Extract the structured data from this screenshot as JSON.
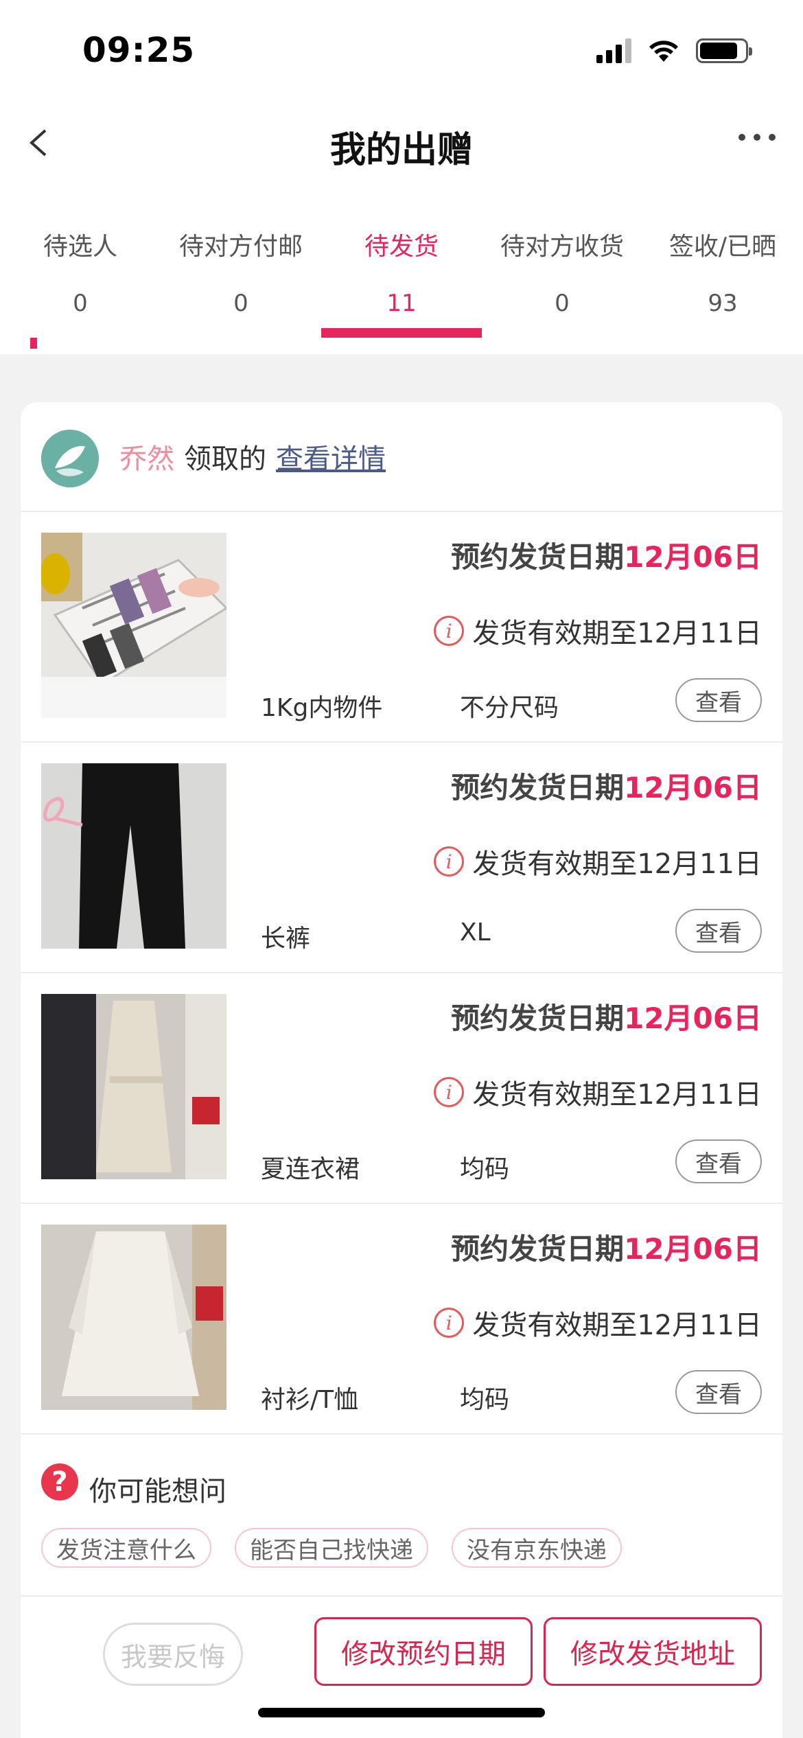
{
  "status_bar": {
    "time": "09:25"
  },
  "nav": {
    "title": "我的出赠"
  },
  "tabs": [
    {
      "label": "待选人",
      "count": "0"
    },
    {
      "label": "待对方付邮",
      "count": "0"
    },
    {
      "label": "待发货",
      "count": "11",
      "active": true
    },
    {
      "label": "待对方收货",
      "count": "0"
    },
    {
      "label": "签收/已晒",
      "count": "93"
    }
  ],
  "card": {
    "receiver": "乔然",
    "received_text": "领取的",
    "detail_link": "查看详情",
    "items": [
      {
        "ship_label": "预约发货日期",
        "ship_date": "12月06日",
        "valid_text": "发货有效期至12月11日",
        "name": "1Kg内物件",
        "size": "不分尺码",
        "view": "查看"
      },
      {
        "ship_label": "预约发货日期",
        "ship_date": "12月06日",
        "valid_text": "发货有效期至12月11日",
        "name": "长裤",
        "size": "XL",
        "view": "查看"
      },
      {
        "ship_label": "预约发货日期",
        "ship_date": "12月06日",
        "valid_text": "发货有效期至12月11日",
        "name": "夏连衣裙",
        "size": "均码",
        "view": "查看"
      },
      {
        "ship_label": "预约发货日期",
        "ship_date": "12月06日",
        "valid_text": "发货有效期至12月11日",
        "name": "衬衫/T恤",
        "size": "均码",
        "view": "查看"
      }
    ],
    "faq": {
      "title": "你可能想问",
      "chips": [
        "发货注意什么",
        "能否自己找快递",
        "没有京东快递"
      ]
    },
    "actions": {
      "regret": "我要反悔",
      "change_date": "修改预约日期",
      "change_address": "修改发货地址"
    }
  },
  "colors": {
    "accent": "#e8245c",
    "receiver": "#f08c9c",
    "link": "#4a5a8a"
  }
}
